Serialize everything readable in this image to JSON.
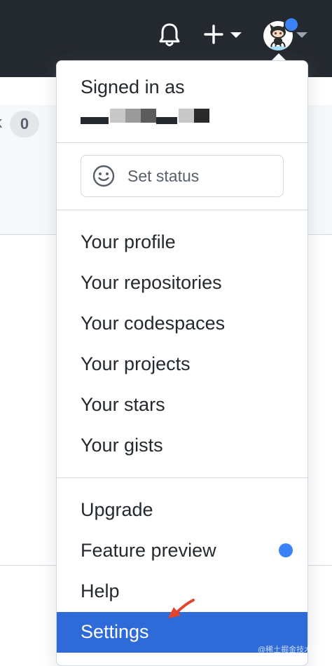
{
  "header": {
    "notifications_icon": "bell-icon",
    "create_icon": "plus-icon",
    "avatar_icon": "octocat-avatar-icon",
    "background": "#24292f"
  },
  "background_page": {
    "counter": "0",
    "fragment": "k"
  },
  "dropdown": {
    "signed_in_label": "Signed in as",
    "set_status_label": "Set status",
    "sections": [
      [
        "Your profile",
        "Your repositories",
        "Your codespaces",
        "Your projects",
        "Your stars",
        "Your gists"
      ],
      [
        "Upgrade",
        "Feature preview",
        "Help",
        "Settings"
      ]
    ],
    "items": {
      "your_profile": "Your profile",
      "your_repositories": "Your repositories",
      "your_codespaces": "Your codespaces",
      "your_projects": "Your projects",
      "your_stars": "Your stars",
      "your_gists": "Your gists",
      "upgrade": "Upgrade",
      "feature_preview": "Feature preview",
      "help": "Help",
      "settings": "Settings"
    },
    "active_item": "Settings",
    "active_color": "#2e6bd8",
    "badge_color": "#3b82f6"
  },
  "watermark": "@稀土掘金技术社区"
}
